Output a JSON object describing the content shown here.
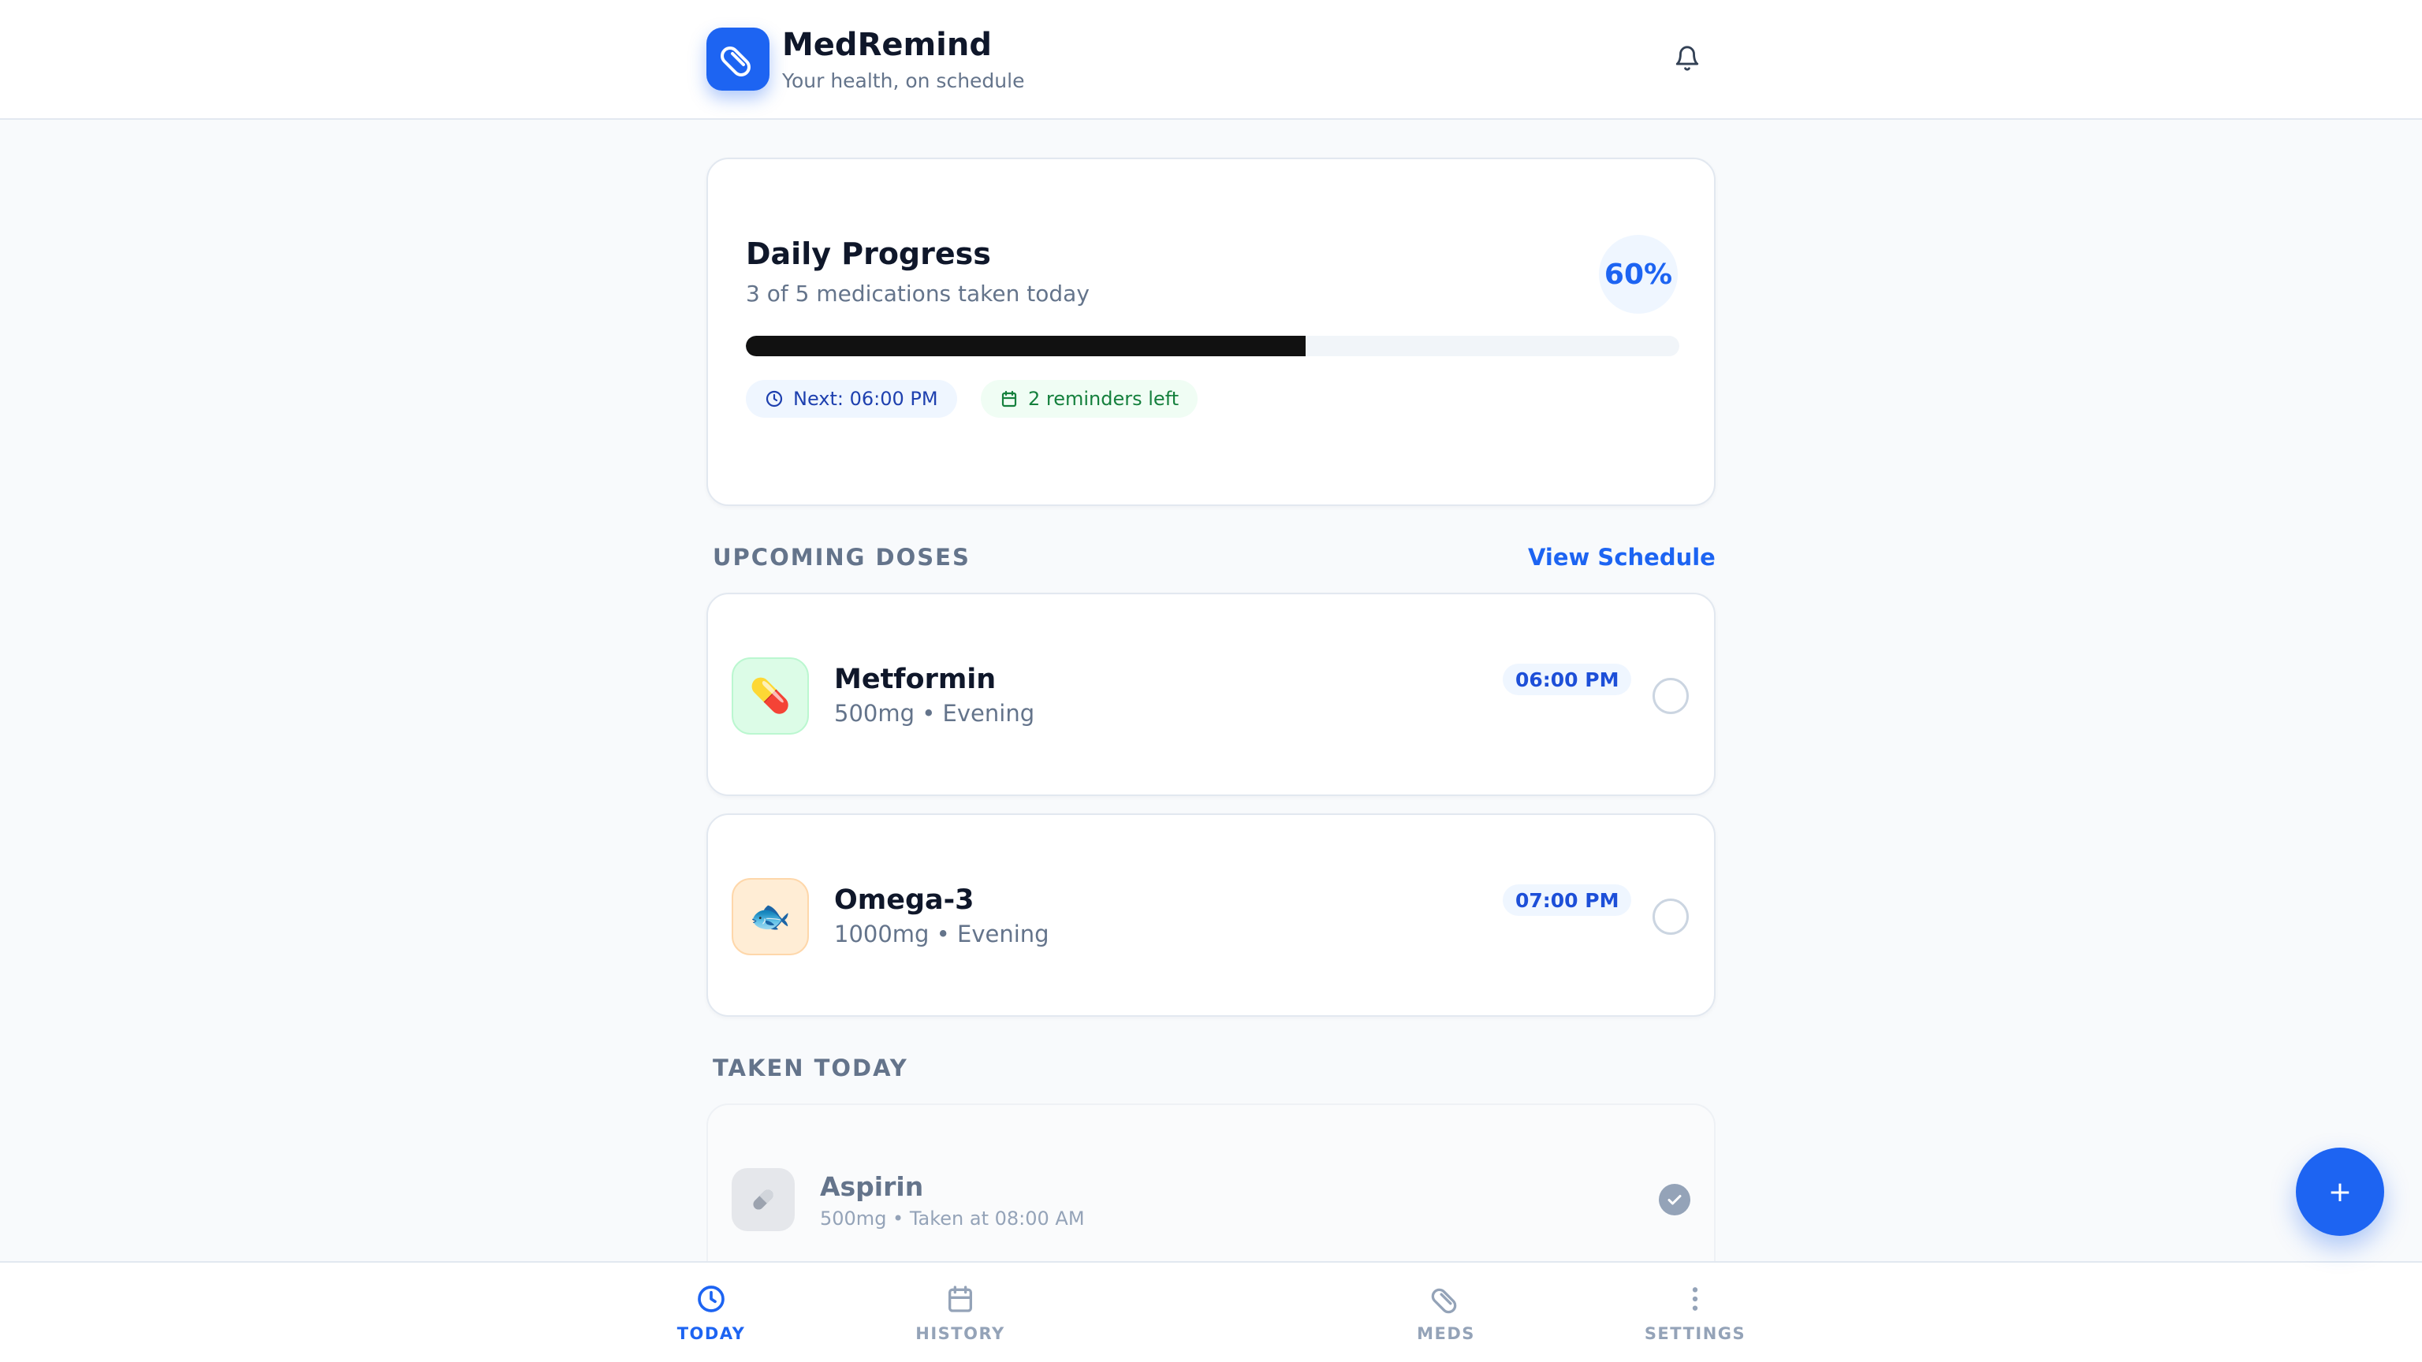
{
  "app": {
    "title": "MedRemind",
    "subtitle": "Your health, on schedule",
    "logo_icon": "pill-icon",
    "notification_icon": "bell-icon"
  },
  "progress": {
    "title": "Daily Progress",
    "summary": "3 of 5 medications taken today",
    "percent_label": "60%",
    "value": 0.6,
    "next_label": "Next: 06:00 PM",
    "reminders_label": "2 reminders left"
  },
  "upcoming": {
    "heading": "UPCOMING DOSES",
    "link": "View Schedule",
    "items": [
      {
        "name": "Metformin",
        "detail": "500mg • Evening",
        "time": "06:00 PM",
        "icon": "💊",
        "tile_color": "#dcfce7",
        "taken": false
      },
      {
        "name": "Omega-3",
        "detail": "1000mg • Evening",
        "time": "07:00 PM",
        "icon": "🐟",
        "tile_color": "#ffedd5",
        "taken": false
      }
    ]
  },
  "taken": {
    "heading": "TAKEN TODAY",
    "items": [
      {
        "name": "Aspirin",
        "detail": "500mg • Taken at 08:00 AM",
        "icon": "pill-icon",
        "taken": true
      }
    ]
  },
  "fab": {
    "label": "+"
  },
  "nav": {
    "items": [
      {
        "label": "TODAY",
        "icon": "clock-icon",
        "active": true
      },
      {
        "label": "HISTORY",
        "icon": "calendar-icon",
        "active": false
      },
      {
        "label": "MEDS",
        "icon": "pill-icon",
        "active": false
      },
      {
        "label": "SETTINGS",
        "icon": "more-vertical-icon",
        "active": false
      }
    ]
  },
  "colors": {
    "accent": "#1d64f2",
    "progress_fill": "#111111",
    "chip_blue_bg": "#eff6ff",
    "chip_green_bg": "#f0fdf4",
    "chip_green_text": "#15803d"
  }
}
